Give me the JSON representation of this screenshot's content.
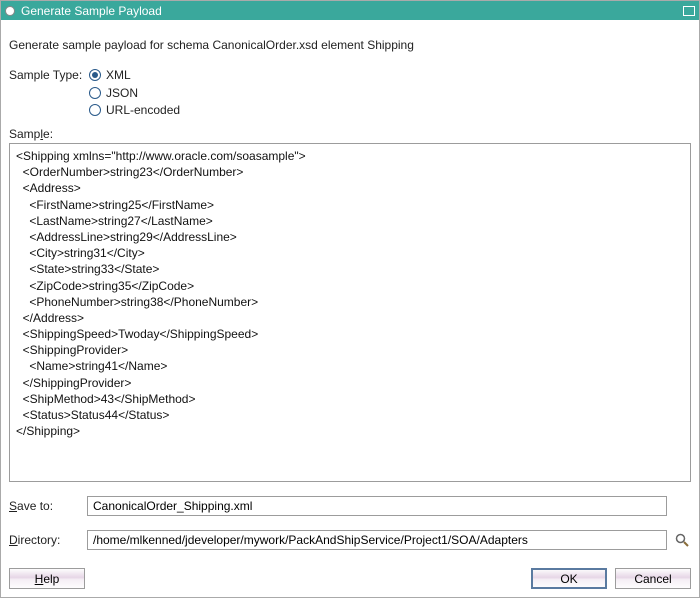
{
  "titlebar": {
    "title": "Generate Sample Payload"
  },
  "description": "Generate sample payload for schema CanonicalOrder.xsd element Shipping",
  "sampleType": {
    "label": "Sample Type:",
    "options": {
      "xml": "XML",
      "json": "JSON",
      "url": "URL-encoded"
    },
    "selected": "xml"
  },
  "sample": {
    "label_pre": "Samp",
    "label_u": "l",
    "label_post": "e:",
    "content": "<Shipping xmlns=\"http://www.oracle.com/soasample\">\n  <OrderNumber>string23</OrderNumber>\n  <Address>\n    <FirstName>string25</FirstName>\n    <LastName>string27</LastName>\n    <AddressLine>string29</AddressLine>\n    <City>string31</City>\n    <State>string33</State>\n    <ZipCode>string35</ZipCode>\n    <PhoneNumber>string38</PhoneNumber>\n  </Address>\n  <ShippingSpeed>Twoday</ShippingSpeed>\n  <ShippingProvider>\n    <Name>string41</Name>\n  </ShippingProvider>\n  <ShipMethod>43</ShipMethod>\n  <Status>Status44</Status>\n</Shipping>"
  },
  "saveTo": {
    "label_u": "S",
    "label_post": "ave to:",
    "value": "CanonicalOrder_Shipping.xml"
  },
  "directory": {
    "label_u": "D",
    "label_post": "irectory:",
    "value": "/home/mlkenned/jdeveloper/mywork/PackAndShipService/Project1/SOA/Adapters"
  },
  "buttons": {
    "help_u": "H",
    "help_post": "elp",
    "ok": "OK",
    "cancel": "Cancel"
  }
}
